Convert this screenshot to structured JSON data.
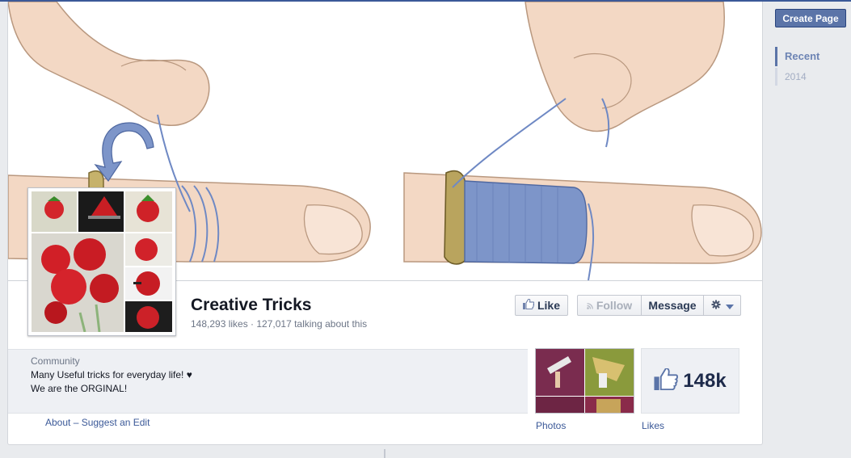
{
  "page": {
    "name": "Creative Tricks",
    "stats": "148,293 likes · 127,017 talking about this"
  },
  "actions": {
    "like": "Like",
    "follow": "Follow",
    "message": "Message"
  },
  "about": {
    "category": "Community",
    "description_line1": "Many Useful tricks for everyday life! ♥",
    "description_line2": "We are the ORGINAL!",
    "about_link": "About",
    "separator": " – ",
    "edit_link": "Suggest an Edit"
  },
  "apps": {
    "photos_label": "Photos",
    "likes_count": "148k",
    "likes_label": "Likes"
  },
  "rail": {
    "create_page": "Create Page",
    "recent": "Recent",
    "year": "2014"
  },
  "colors": {
    "brand": "#3b5998",
    "thread": "#7d95c9",
    "skin": "#f1d3bd"
  },
  "icons": {
    "like": "thumbs-up-icon",
    "follow": "rss-icon",
    "settings": "gear-icon",
    "dropdown": "caret-down-icon",
    "likes_app": "thumbs-up-icon"
  }
}
